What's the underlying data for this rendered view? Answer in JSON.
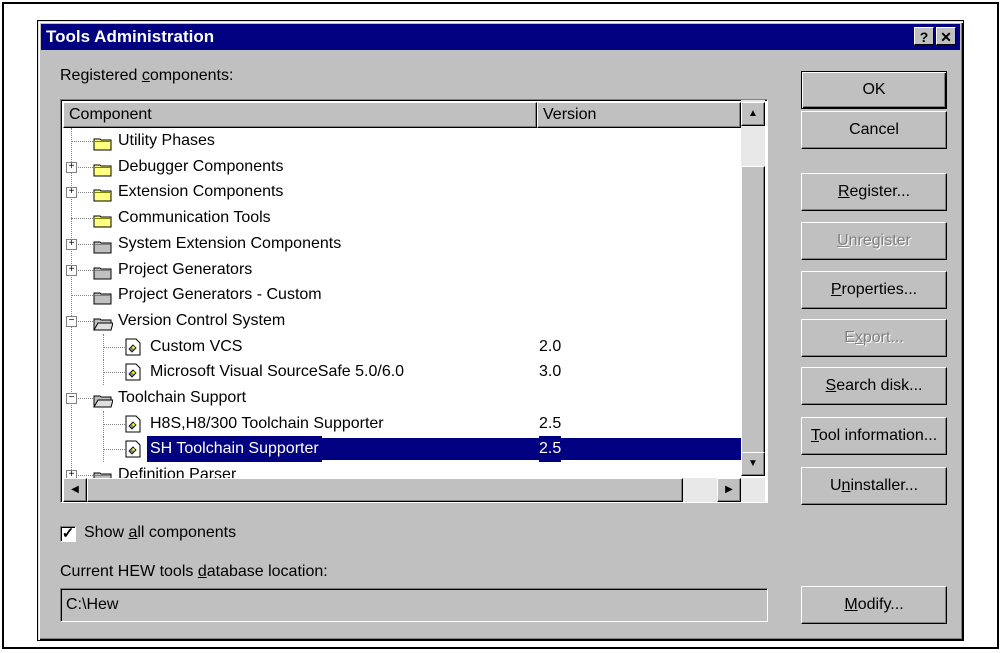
{
  "dialog": {
    "title": "Tools Administration",
    "help_glyph": "?",
    "close_glyph": "✕"
  },
  "registered_label_pre": "Registered ",
  "registered_label_key": "c",
  "registered_label_post": "omponents:",
  "columns": {
    "component": "Component",
    "version": "Version"
  },
  "rows": [
    {
      "label": "Utility Phases",
      "version": "",
      "icon": "folder-yellow",
      "expander": "",
      "level": 0
    },
    {
      "label": "Debugger Components",
      "version": "",
      "icon": "folder-yellow",
      "expander": "+",
      "level": 0
    },
    {
      "label": "Extension Components",
      "version": "",
      "icon": "folder-yellow",
      "expander": "+",
      "level": 0
    },
    {
      "label": "Communication Tools",
      "version": "",
      "icon": "folder-yellow",
      "expander": "",
      "level": 0
    },
    {
      "label": "System Extension Components",
      "version": "",
      "icon": "folder-gray",
      "expander": "+",
      "level": 0
    },
    {
      "label": "Project Generators",
      "version": "",
      "icon": "folder-gray",
      "expander": "+",
      "level": 0
    },
    {
      "label": "Project Generators - Custom",
      "version": "",
      "icon": "folder-gray",
      "expander": "",
      "level": 0
    },
    {
      "label": "Version Control System",
      "version": "",
      "icon": "folder-open-gray",
      "expander": "−",
      "level": 0
    },
    {
      "label": "Custom VCS",
      "version": "2.0",
      "icon": "component",
      "expander": "",
      "level": 1
    },
    {
      "label": "Microsoft Visual SourceSafe 5.0/6.0",
      "version": "3.0",
      "icon": "component",
      "expander": "",
      "level": 1
    },
    {
      "label": "Toolchain Support",
      "version": "",
      "icon": "folder-open-gray",
      "expander": "−",
      "level": 0
    },
    {
      "label": "H8S,H8/300 Toolchain Supporter",
      "version": "2.5",
      "icon": "component",
      "expander": "",
      "level": 1
    },
    {
      "label": "SH Toolchain Supporter",
      "version": "2.5",
      "icon": "component",
      "expander": "",
      "level": 1,
      "selected": true
    },
    {
      "label": "Definition Parser",
      "version": "",
      "icon": "folder-gray",
      "expander": "+",
      "level": 0
    }
  ],
  "buttons": {
    "ok": "OK",
    "cancel": "Cancel",
    "register_key": "R",
    "register_rest": "egister...",
    "unregister_key": "U",
    "unregister_rest": "nregister",
    "properties_key": "P",
    "properties_rest": "roperties...",
    "export_pre": "E",
    "export_key": "x",
    "export_rest": "port...",
    "search_key": "S",
    "search_rest": "earch disk...",
    "toolinfo_key": "T",
    "toolinfo_rest": "ool information...",
    "uninstaller_pre": "U",
    "uninstaller_key": "n",
    "uninstaller_rest": "installer...",
    "modify_key": "M",
    "modify_rest": "odify..."
  },
  "show_all": {
    "pre": "Show ",
    "key": "a",
    "post": "ll components",
    "checked": true,
    "check_glyph": "✓"
  },
  "db_location_label_pre": "Current HEW tools ",
  "db_location_label_key": "d",
  "db_location_label_post": "atabase location:",
  "db_location_value": "C:\\Hew",
  "scroll_glyphs": {
    "up": "▲",
    "down": "▼",
    "left": "◀",
    "right": "▶"
  }
}
